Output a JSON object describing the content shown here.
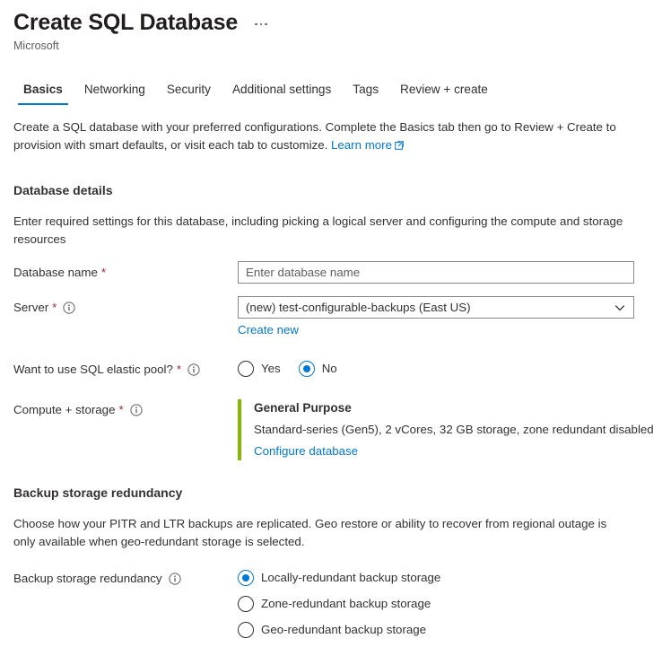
{
  "header": {
    "title": "Create SQL Database",
    "publisher": "Microsoft",
    "more_menu_label": "More"
  },
  "tabs": [
    {
      "label": "Basics",
      "active": true
    },
    {
      "label": "Networking",
      "active": false
    },
    {
      "label": "Security",
      "active": false
    },
    {
      "label": "Additional settings",
      "active": false
    },
    {
      "label": "Tags",
      "active": false
    },
    {
      "label": "Review + create",
      "active": false
    }
  ],
  "intro": {
    "text": "Create a SQL database with your preferred configurations. Complete the Basics tab then go to Review + Create to provision with smart defaults, or visit each tab to customize.",
    "link_label": "Learn more"
  },
  "database_details": {
    "section_title": "Database details",
    "description": "Enter required settings for this database, including picking a logical server and configuring the compute and storage resources",
    "database_name": {
      "label": "Database name",
      "required_marker": "*",
      "value": "",
      "placeholder": "Enter database name"
    },
    "server": {
      "label": "Server",
      "required_marker": "*",
      "value": "(new) test-configurable-backups (East US)",
      "create_new_label": "Create new"
    },
    "elastic_pool": {
      "label": "Want to use SQL elastic pool?",
      "required_marker": "*",
      "options": [
        {
          "label": "Yes",
          "selected": false
        },
        {
          "label": "No",
          "selected": true
        }
      ]
    },
    "compute_storage": {
      "label": "Compute + storage",
      "required_marker": "*",
      "tier": "General Purpose",
      "details": "Standard-series (Gen5), 2 vCores, 32 GB storage, zone redundant disabled",
      "configure_link": "Configure database"
    }
  },
  "backup_storage_redundancy": {
    "section_title": "Backup storage redundancy",
    "description": "Choose how your PITR and LTR backups are replicated. Geo restore or ability to recover from regional outage is only available when geo-redundant storage is selected.",
    "field_label": "Backup storage redundancy",
    "options": [
      {
        "label": "Locally-redundant backup storage",
        "selected": true
      },
      {
        "label": "Zone-redundant backup storage",
        "selected": false
      },
      {
        "label": "Geo-redundant backup storage",
        "selected": false
      }
    ]
  },
  "colors": {
    "accent_blue": "#0078d4",
    "accent_green": "#7fba00",
    "required_red": "#a4262c",
    "text": "#323130",
    "muted_text": "#605e5c",
    "border": "#8a8886"
  }
}
